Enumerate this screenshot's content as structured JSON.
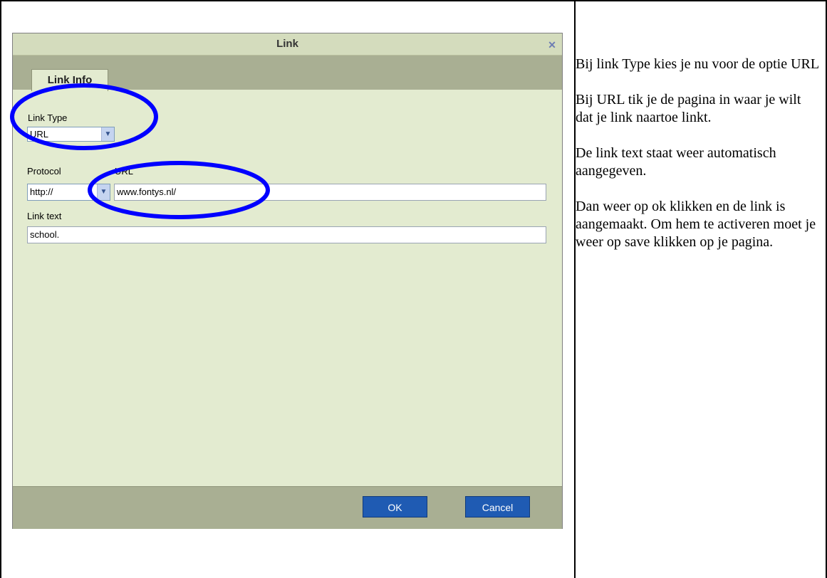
{
  "dialog": {
    "title": "Link",
    "close_glyph": "✕",
    "tab_label": "Link Info",
    "link_type_label": "Link Type",
    "link_type_value": "URL",
    "protocol_label": "Protocol",
    "protocol_value": "http://",
    "url_label": "URL",
    "url_value": "www.fontys.nl/",
    "link_text_label": "Link text",
    "link_text_value": "school.",
    "ok_label": "OK",
    "cancel_label": "Cancel"
  },
  "instructions": [
    "Bij link Type kies je nu voor de optie URL",
    "Bij URL tik je de pagina in waar je wilt dat je link naartoe linkt.",
    "De link text staat weer automatisch aangegeven.",
    "Dan weer op ok klikken en de link is aangemaakt. Om hem te activeren moet je weer op save klikken op je pagina."
  ],
  "colors": {
    "annotation_circle": "#0000ff",
    "ok_button": "#1f5bb3",
    "dialog_bg": "#e3ebd0"
  },
  "icons": {
    "close": "close-icon",
    "dropdown": "chevron-down-icon"
  }
}
